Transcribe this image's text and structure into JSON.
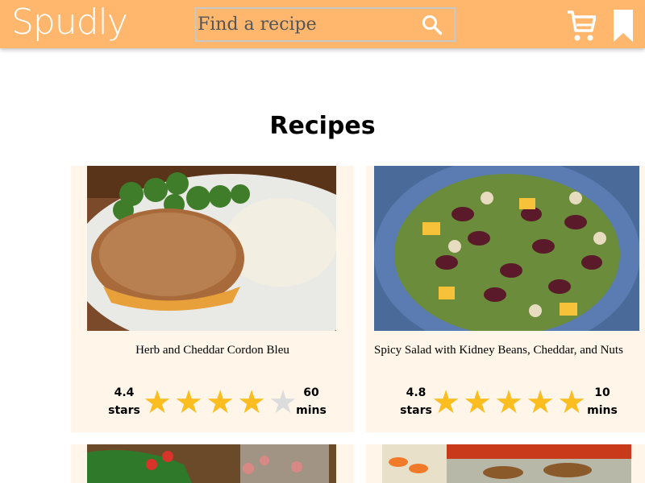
{
  "header": {
    "logo": "Spudly",
    "search_placeholder": "Find a recipe",
    "icons": [
      "search-icon",
      "cart-icon",
      "bookmark-icon"
    ]
  },
  "page": {
    "title": "Recipes"
  },
  "colors": {
    "header_bg": "#ffb76e",
    "card_bg": "#fff5e9",
    "star_on": "#fbbd1f",
    "star_off": "#dcdcdc"
  },
  "recipes": [
    {
      "name": "Herb and Cheddar Cordon Bleu",
      "rating": "4.4",
      "rating_unit": "stars",
      "rating_value": 4.4,
      "time": "60",
      "time_unit": "mins"
    },
    {
      "name": "Spicy Salad with Kidney Beans, Cheddar, and Nuts",
      "rating": "4.8",
      "rating_unit": "stars",
      "rating_value": 4.8,
      "time": "10",
      "time_unit": "mins"
    }
  ]
}
